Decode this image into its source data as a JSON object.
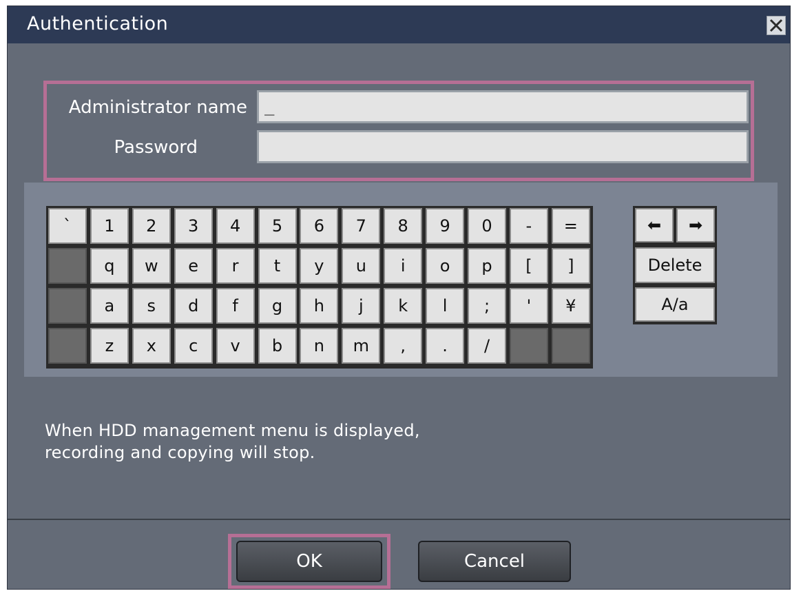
{
  "dialog": {
    "title": "Authentication",
    "close_icon": "close-icon"
  },
  "credentials": {
    "admin_label": "Administrator name",
    "admin_value": "_",
    "password_label": "Password",
    "password_value": ""
  },
  "keyboard": {
    "rows": [
      [
        "`",
        "1",
        "2",
        "3",
        "4",
        "5",
        "6",
        "7",
        "8",
        "9",
        "0",
        "-",
        "="
      ],
      [
        "",
        "q",
        "w",
        "e",
        "r",
        "t",
        "y",
        "u",
        "i",
        "o",
        "p",
        "[",
        "]"
      ],
      [
        "",
        "a",
        "s",
        "d",
        "f",
        "g",
        "h",
        "j",
        "k",
        "l",
        ";",
        "'",
        "¥"
      ],
      [
        "",
        "z",
        "x",
        "c",
        "v",
        "b",
        "n",
        "m",
        ",",
        ".",
        "/",
        "",
        ""
      ]
    ],
    "left_arrow": "⬅",
    "right_arrow": "➡",
    "delete_label": "Delete",
    "case_label": "A/a"
  },
  "note": {
    "line1": "When HDD management menu is displayed,",
    "line2": "recording and copying will stop."
  },
  "buttons": {
    "ok_label": "OK",
    "cancel_label": "Cancel"
  },
  "colors": {
    "title_bar": "#2d3a55",
    "dialog_bg": "#646b77",
    "highlight": "#b66f95"
  }
}
